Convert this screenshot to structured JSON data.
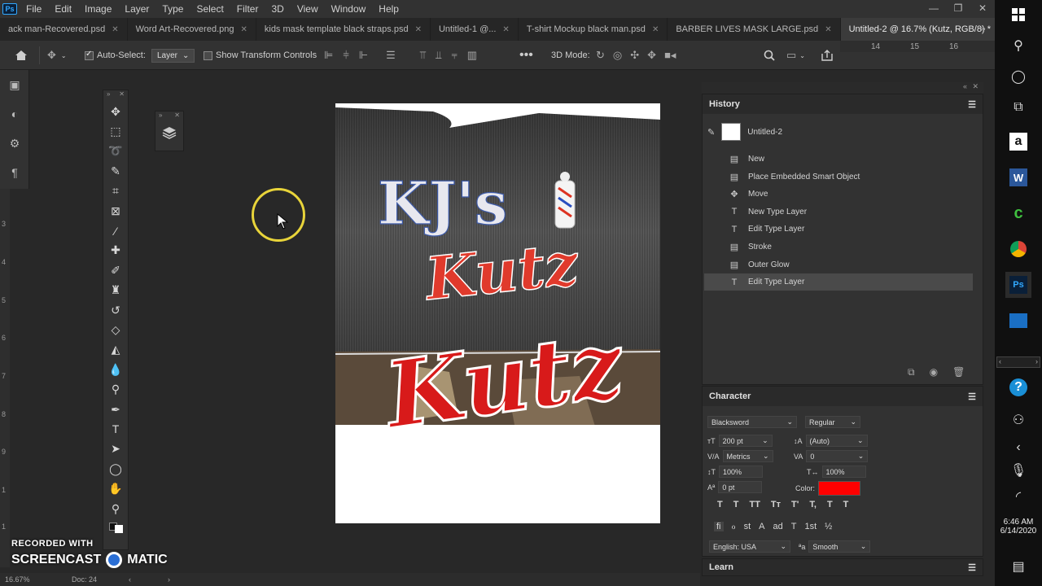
{
  "menu": {
    "app_logo": "Ps",
    "items": [
      "File",
      "Edit",
      "Image",
      "Layer",
      "Type",
      "Select",
      "Filter",
      "3D",
      "View",
      "Window",
      "Help"
    ]
  },
  "tabs": [
    {
      "label": "ack man-Recovered.psd"
    },
    {
      "label": "Word Art-Recovered.png"
    },
    {
      "label": "kids mask template black straps.psd"
    },
    {
      "label": "Untitled-1 @..."
    },
    {
      "label": "T-shirt Mockup black man.psd"
    },
    {
      "label": "BARBER LIVES MASK LARGE.psd"
    },
    {
      "label": "Untitled-2 @ 16.7% (Kutz, RGB/8) *",
      "active": true
    }
  ],
  "options": {
    "auto_select_label": "Auto-Select:",
    "auto_select_value": "Layer",
    "show_transform_label": "Show Transform Controls",
    "mode_3d_label": "3D Mode:",
    "ruler_marks": [
      "14",
      "15",
      "16"
    ]
  },
  "ruler_marks_vertical": [
    "3",
    "4",
    "5",
    "6",
    "7",
    "8",
    "9",
    "1",
    "1"
  ],
  "canvas": {
    "text_kjs": "KJ's",
    "text_kutz_small": "Kutz",
    "text_kutz_large": "Kutz"
  },
  "history": {
    "title": "History",
    "snapshot_label": "Untitled-2",
    "items": [
      {
        "label": "New",
        "icon": "doc"
      },
      {
        "label": "Place Embedded Smart Object",
        "icon": "doc"
      },
      {
        "label": "Move",
        "icon": "move"
      },
      {
        "label": "New Type Layer",
        "icon": "type"
      },
      {
        "label": "Edit Type Layer",
        "icon": "type"
      },
      {
        "label": "Stroke",
        "icon": "doc"
      },
      {
        "label": "Outer Glow",
        "icon": "doc"
      },
      {
        "label": "Edit Type Layer",
        "icon": "type",
        "selected": true
      }
    ]
  },
  "character": {
    "title": "Character",
    "font_family": "Blacksword",
    "font_style": "Regular",
    "font_size": "200 pt",
    "leading": "(Auto)",
    "kerning": "Metrics",
    "tracking": "0",
    "vertical_scale": "100%",
    "horizontal_scale": "100%",
    "baseline_shift": "0 pt",
    "color_label": "Color:",
    "color_value": "#ff0000",
    "type_buttons": [
      "T",
      "T",
      "TT",
      "Tт",
      "T'",
      "T,",
      "T",
      "T"
    ],
    "opentype_buttons": [
      "fi",
      "ℴ",
      "st",
      "A",
      "ad",
      "T",
      "1st",
      "½"
    ],
    "language": "English: USA",
    "antialias": "Smooth"
  },
  "learn": {
    "title": "Learn"
  },
  "status": {
    "zoom": "16.67%",
    "doc": "Doc: 24"
  },
  "watermark": {
    "line1": "RECORDED WITH",
    "line2a": "SCREENCAST",
    "line2b": "MATIC"
  },
  "taskbar": {
    "time": "6:46 AM",
    "date": "6/14/2020"
  }
}
